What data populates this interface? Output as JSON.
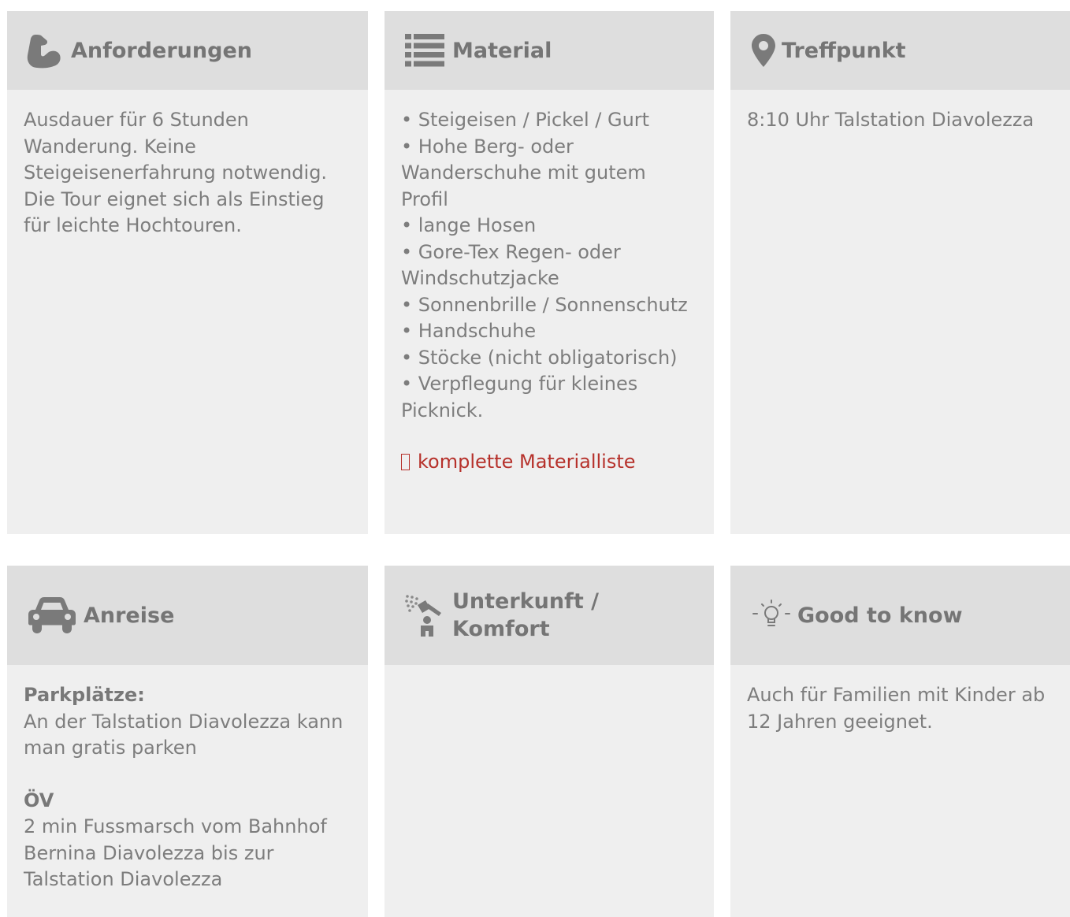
{
  "colors": {
    "card_bg": "#efefef",
    "header_bg": "#dedede",
    "text": "#7d7d7d",
    "link": "#b6312b"
  },
  "cards": {
    "anforderungen": {
      "icon": "flexed-arm-icon",
      "title": "Anforderungen",
      "text": "Ausdauer für 6 Stunden Wanderung. Keine Steigeisenerfahrung notwendig. Die Tour eignet sich als Einstieg für leichte Hochtouren."
    },
    "material": {
      "icon": "list-icon",
      "title": "Material",
      "items": [
        "• Steigeisen / Pickel / Gurt",
        "• Hohe Berg- oder Wanderschuhe mit gutem Profil",
        "• lange Hosen",
        "• Gore-Tex Regen- oder Windschutzjacke",
        "• Sonnenbrille / Sonnenschutz",
        "• Handschuhe",
        "• Stöcke (nicht obligatorisch)",
        "• Verpflegung für kleines Picknick."
      ],
      "link_label": "komplette Materialliste"
    },
    "treffpunkt": {
      "icon": "map-pin-icon",
      "title": "Treffpunkt",
      "text": "8:10 Uhr Talstation Diavolezza"
    },
    "anreise": {
      "icon": "car-icon",
      "title": "Anreise",
      "parking_heading": "Parkplätze:",
      "parking_text": "An der Talstation Diavolezza kann man gratis parken",
      "ov_heading": "ÖV",
      "ov_text": "2 min Fussmarsch vom Bahnhof Bernina Diavolezza bis zur Talstation Diavolezza"
    },
    "unterkunft": {
      "icon": "shower-icon",
      "title": "Unterkunft / Komfort"
    },
    "good_to_know": {
      "icon": "lightbulb-icon",
      "title": "Good to know",
      "text": "Auch für Familien mit Kinder ab 12 Jahren geeignet."
    }
  }
}
